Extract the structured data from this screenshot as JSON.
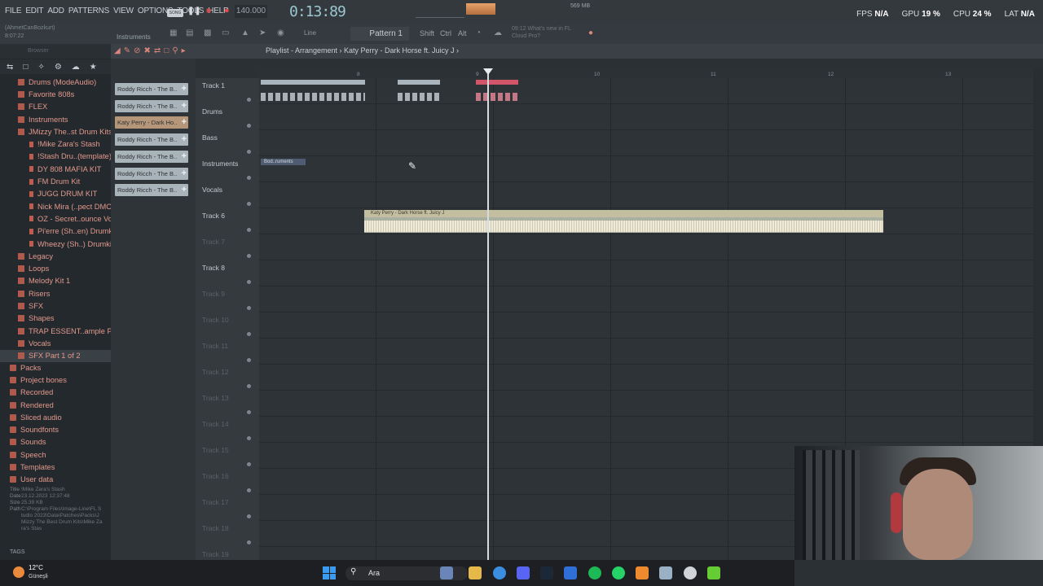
{
  "menu": [
    "FILE",
    "EDIT",
    "ADD",
    "PATTERNS",
    "VIEW",
    "OPTIONS",
    "TOOLS",
    "HELP"
  ],
  "transport": {
    "mode": "SONG",
    "play_icon": "pause-icon",
    "stop_icon": "stop-icon",
    "record_icon": "record-icon",
    "tempo": "140.000",
    "time": "0:13:89"
  },
  "system": {
    "fps_label": "FPS",
    "fps_value": "N/A",
    "gpu_label": "GPU",
    "gpu_value": "19 %",
    "cpu_label": "CPU",
    "cpu_value": "24 %",
    "lat_label": "LAT",
    "lat_value": "N/A",
    "memory": "569 MB"
  },
  "hint": {
    "title": "(AhmetCanBozkurt)",
    "sub": "8:07:22"
  },
  "toolbar2": {
    "instruments_label": "Instruments",
    "snap": "Line",
    "pattern": "Pattern 1",
    "shift": "Shift",
    "ctrl": "Ctrl",
    "alt": "Alt",
    "whats_new_time": "09:12",
    "whats_new": "What's new in FL Cloud Pro?"
  },
  "browser": {
    "title": "Browser",
    "tree": [
      {
        "label": "Drums (ModeAudio)",
        "level": 0
      },
      {
        "label": "Favorite 808s",
        "level": 0
      },
      {
        "label": "FLEX",
        "level": 0
      },
      {
        "label": "Instruments",
        "level": 0
      },
      {
        "label": "JMizzy The..st Drum Kits",
        "level": 0
      },
      {
        "label": "!Mike Zara's Stash",
        "level": 1
      },
      {
        "label": "!Stash Dru..(template)",
        "level": 1
      },
      {
        "label": "DY 808 MAFIA KIT",
        "level": 1
      },
      {
        "label": "FM Drum Kit",
        "level": 1
      },
      {
        "label": "JUGG DRUM KIT",
        "level": 1
      },
      {
        "label": "Nick Mira (..pect DMCA",
        "level": 1
      },
      {
        "label": "OZ - Secret..ounce Vol.1",
        "level": 1
      },
      {
        "label": "Pi'erre (Sh..en) Drumkit",
        "level": 1
      },
      {
        "label": "Wheezy (Sh..) Drumkit",
        "level": 1
      },
      {
        "label": "Legacy",
        "level": 0
      },
      {
        "label": "Loops",
        "level": 0
      },
      {
        "label": "Melody Kit 1",
        "level": 0
      },
      {
        "label": "Risers",
        "level": 0
      },
      {
        "label": "SFX",
        "level": 0
      },
      {
        "label": "Shapes",
        "level": 0
      },
      {
        "label": "TRAP ESSENT..ample Pack]",
        "level": 0
      },
      {
        "label": "Vocals",
        "level": 0
      },
      {
        "label": "SFX Part 1 of 2",
        "level": 0
      }
    ],
    "roots": [
      "Packs",
      "Project bones",
      "Recorded",
      "Rendered",
      "Sliced audio",
      "Soundfonts",
      "Sounds",
      "Speech",
      "Templates",
      "User data"
    ],
    "info": {
      "title_k": "Title",
      "title_v": "!Mike Zara's Stash",
      "date_k": "Date",
      "date_v": "23.12.2023 12:37:48",
      "size_k": "Size",
      "size_v": "25.39 KB",
      "path_k": "Path",
      "path_v": "C:\\Program Files\\Image-Line\\FL Studio 2023\\Data\\Patches\\Packs\\JMizzy The Best Drum Kits\\Mike Zara's Stas"
    },
    "tags": "TAGS"
  },
  "channels": [
    {
      "label": "Roddy Ricch - The B..",
      "color": "#a9b3ba"
    },
    {
      "label": "Roddy Ricch - The B..",
      "color": "#a9b3ba"
    },
    {
      "label": "Katy Perry - Dark Ho..",
      "color": "#b69678"
    },
    {
      "label": "Roddy Ricch - The B..",
      "color": "#a9b3ba"
    },
    {
      "label": "Roddy Ricch - The B..",
      "color": "#a9b3ba"
    },
    {
      "label": "Roddy Ricch - The B..",
      "color": "#a9b3ba"
    },
    {
      "label": "Roddy Ricch - The B..",
      "color": "#a9b3ba"
    }
  ],
  "playlist": {
    "title": "Playlist - Arrangement › Katy Perry - Dark Horse ft. Juicy J ›",
    "ruler": [
      "8",
      "9",
      "10",
      "11",
      "12",
      "13"
    ],
    "tracks": [
      "Track 1",
      "Drums",
      "Bass",
      "Instruments",
      "Vocals",
      "Track 6",
      "Track 7",
      "Track 8",
      "Track 9",
      "Track 10",
      "Track 11",
      "Track 12",
      "Track 13",
      "Track 14",
      "Track 15",
      "Track 16",
      "Track 17",
      "Track 18",
      "Track 19"
    ],
    "audio_clip": "Katy Perry - Dark Horse ft. Juicy J",
    "instr_clip": "Bod..ruments",
    "colors": {
      "pattern_red": "#d2556a",
      "audio": "#c4bea0",
      "instruments": "#4f5c72"
    }
  },
  "taskbar": {
    "temp": "12°C",
    "weather": "Güneşli",
    "search": "Ara"
  }
}
